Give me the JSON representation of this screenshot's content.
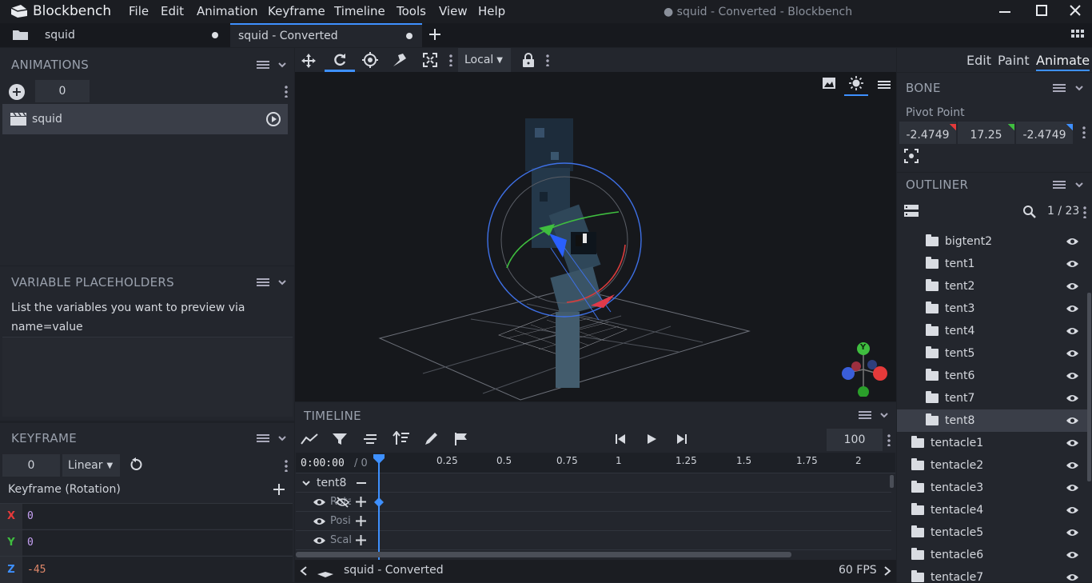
{
  "app": {
    "logo_text": "Blockbench",
    "window_title": "● squid - Converted - Blockbench"
  },
  "menu": [
    "File",
    "Edit",
    "Animation",
    "Keyframe",
    "Timeline",
    "Tools",
    "View",
    "Help"
  ],
  "tabs": [
    {
      "label": "squid"
    },
    {
      "label": "squid - Converted"
    }
  ],
  "modes": {
    "edit": "Edit",
    "paint": "Paint",
    "animate": "Animate"
  },
  "toolbar": {
    "space": "Local"
  },
  "animations": {
    "title": "ANIMATIONS",
    "counter": "0",
    "items": [
      {
        "name": "squid"
      }
    ]
  },
  "variables": {
    "title": "VARIABLE PLACEHOLDERS",
    "text": "List the variables you want to preview via name=value"
  },
  "keyframe": {
    "title": "KEYFRAME",
    "time": "0",
    "interpolation": "Linear",
    "label": "Keyframe (Rotation)",
    "x_label": "X",
    "x": "0",
    "y_label": "Y",
    "y": "0",
    "z_label": "Z",
    "z": "-45"
  },
  "bone": {
    "title": "BONE",
    "pivot_label": "Pivot Point",
    "pivot": [
      "-2.4749",
      "17.25",
      "-2.4749"
    ]
  },
  "outliner": {
    "title": "OUTLINER",
    "count": "1 / 23",
    "items": [
      "bigtent2",
      "tent1",
      "tent2",
      "tent3",
      "tent4",
      "tent5",
      "tent6",
      "tent7",
      "tent8"
    ],
    "items2": [
      "tentacle1",
      "tentacle2",
      "tentacle3",
      "tentacle4",
      "tentacle5",
      "tentacle6",
      "tentacle7"
    ]
  },
  "timeline": {
    "title": "TIMELINE",
    "speed": "100",
    "time": "0:00:00",
    "time_total": "/ 0",
    "ticks": [
      "0.25",
      "0.5",
      "0.75",
      "1",
      "1.25",
      "1.5",
      "1.75",
      "2"
    ],
    "bone": "tent8",
    "channels": [
      "Rotation",
      "Position",
      "Scale"
    ],
    "footer_name": "squid - Converted",
    "fps": "60 FPS"
  },
  "gizmo": {
    "y": "Y"
  },
  "colors": {
    "accent": "#3e90ff",
    "x": "#e53a3a",
    "y": "#3fbe3f",
    "z": "#3e90ff"
  }
}
